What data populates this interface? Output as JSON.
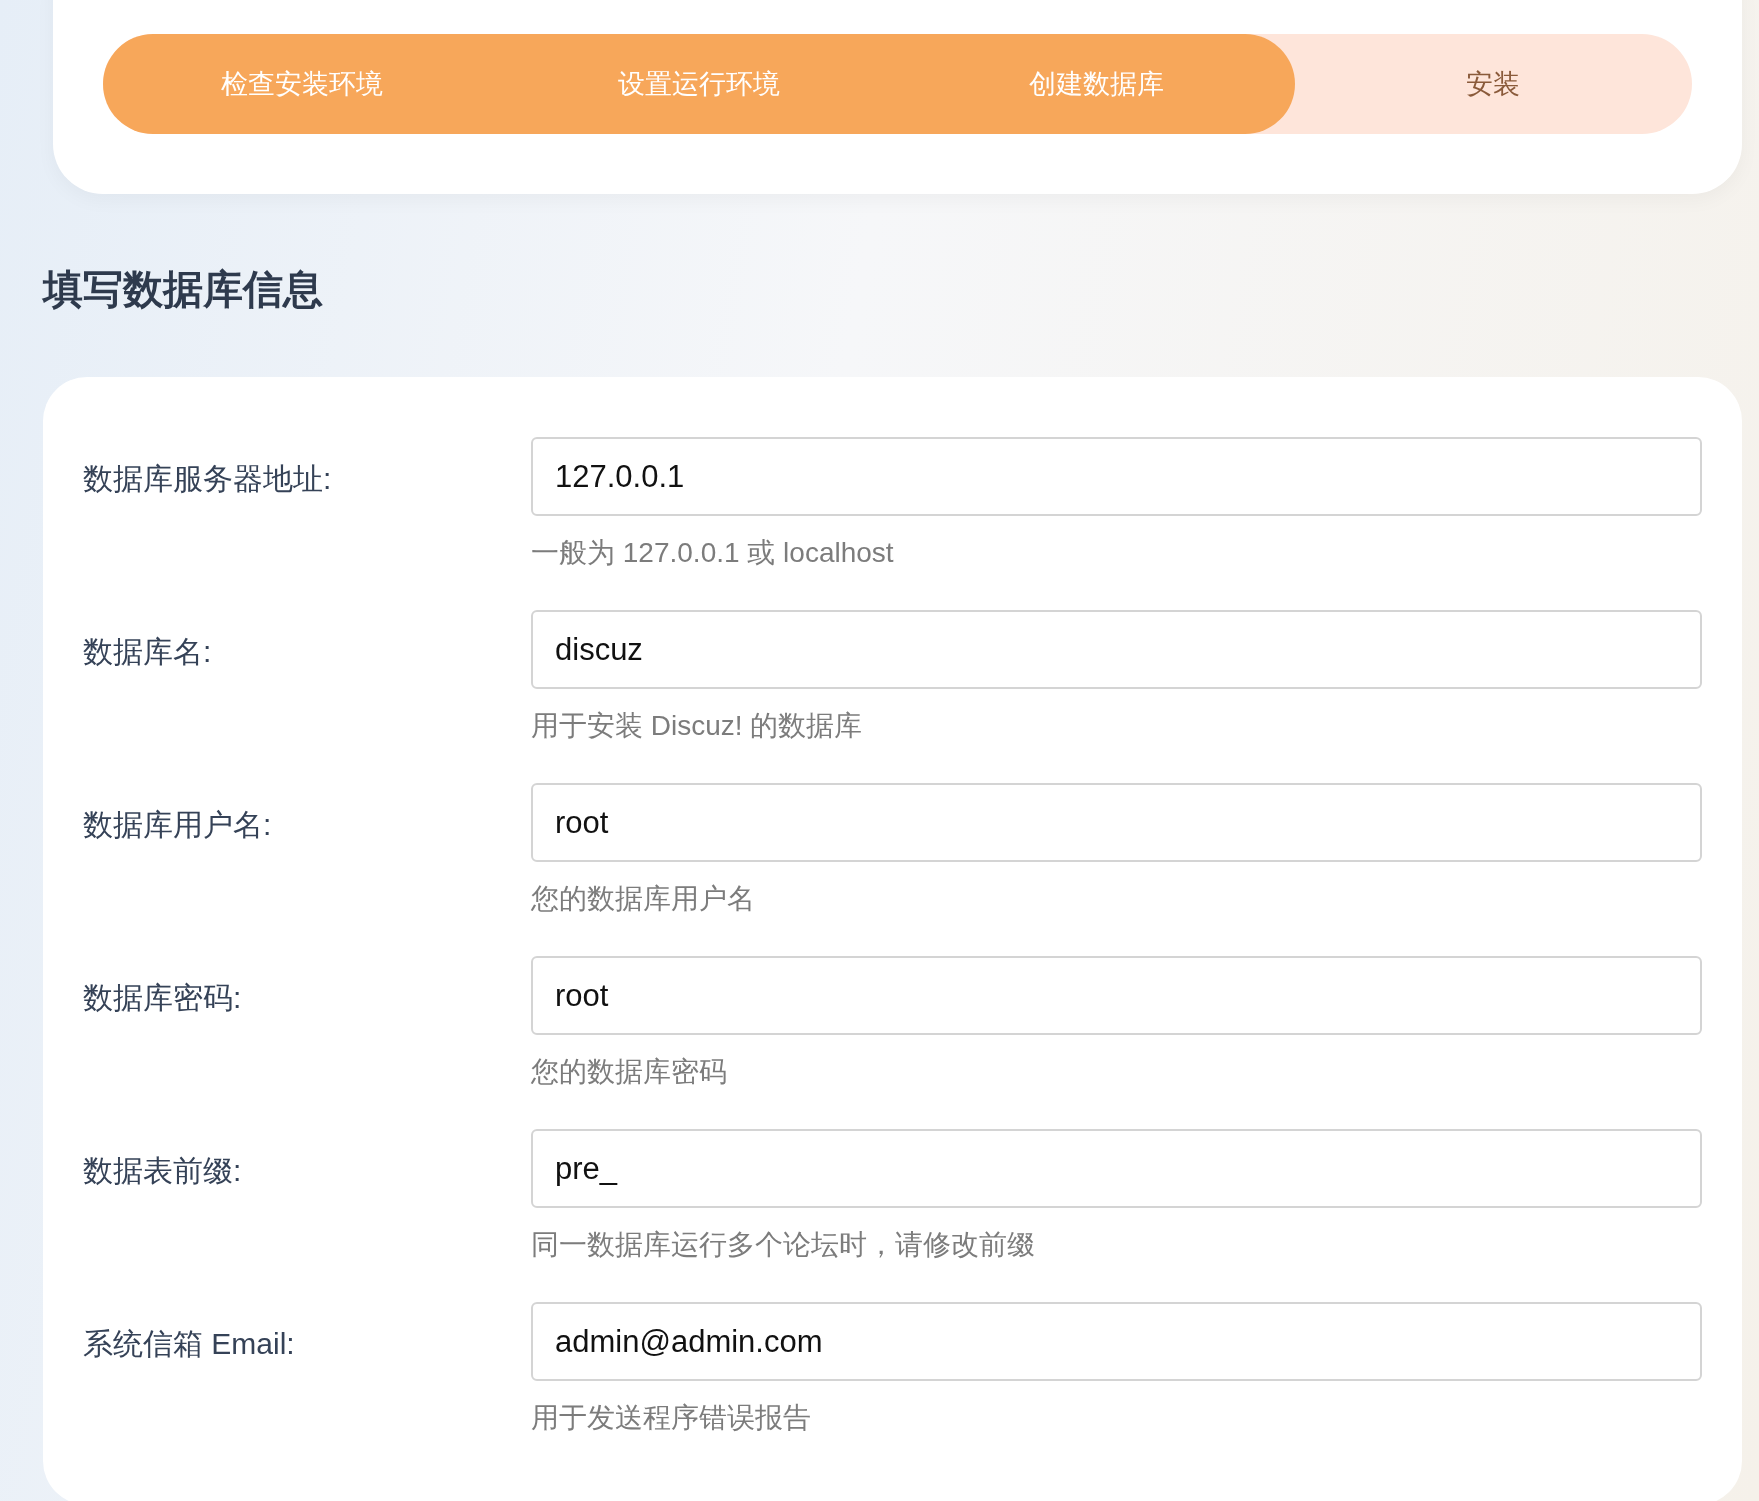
{
  "steps": [
    {
      "label": "检查安装环境",
      "done": true
    },
    {
      "label": "设置运行环境",
      "done": true
    },
    {
      "label": "创建数据库",
      "done": true
    },
    {
      "label": "安装",
      "done": false
    }
  ],
  "heading": "填写数据库信息",
  "fields": [
    {
      "label": "数据库服务器地址:",
      "value": "127.0.0.1",
      "hint": "一般为 127.0.0.1 或 localhost"
    },
    {
      "label": "数据库名:",
      "value": "discuz",
      "hint": "用于安装 Discuz! 的数据库"
    },
    {
      "label": "数据库用户名:",
      "value": "root",
      "hint": "您的数据库用户名"
    },
    {
      "label": "数据库密码:",
      "value": "root",
      "hint": "您的数据库密码"
    },
    {
      "label": "数据表前缀:",
      "value": "pre_",
      "hint": "同一数据库运行多个论坛时，请修改前缀"
    },
    {
      "label": "系统信箱 Email:",
      "value": "admin@admin.com",
      "hint": "用于发送程序错误报告"
    }
  ]
}
